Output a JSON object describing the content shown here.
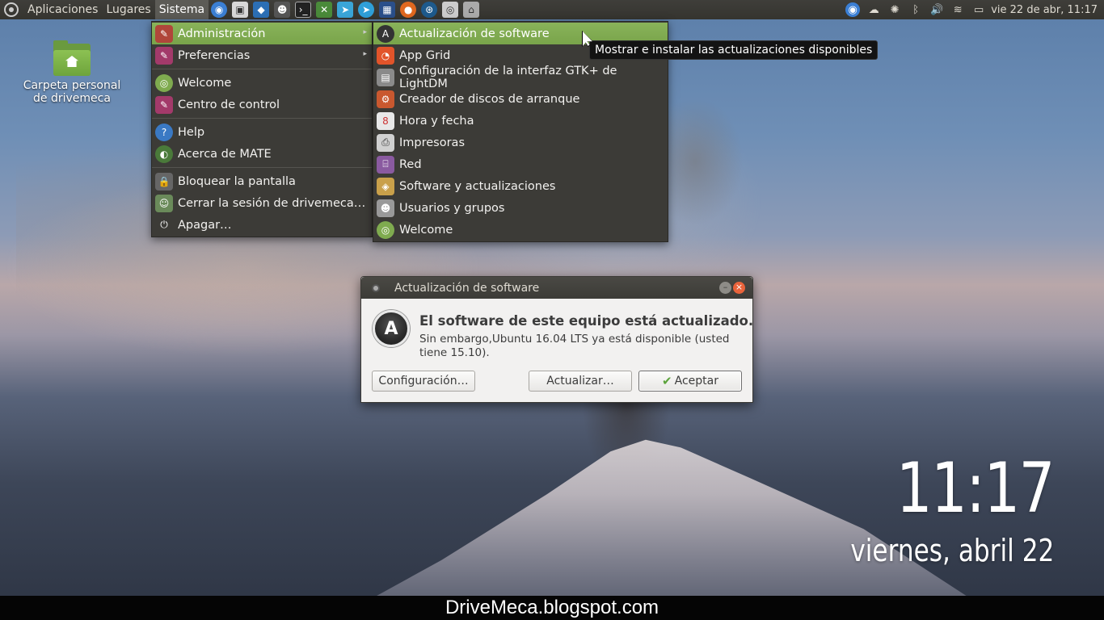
{
  "panel": {
    "menus": [
      "Aplicaciones",
      "Lugares",
      "Sistema"
    ],
    "launchers": [
      "chromium-icon",
      "screenshot-icon",
      "virtualbox-icon",
      "app-icon",
      "terminal-icon",
      "tools-icon",
      "telegram-icon",
      "telegram-desktop-icon",
      "calculator-icon",
      "firefox-icon",
      "steam-icon",
      "disk-icon",
      "network-icon"
    ],
    "clock": "vie 22 de abr, 11:17"
  },
  "desktop": {
    "home_folder_label": "Carpeta personal de drivemeca",
    "clock_time": "11:17",
    "clock_date": "viernes, abril 22"
  },
  "system_menu": {
    "items": [
      {
        "label": "Administración",
        "icon": "admin-icon"
      },
      {
        "label": "Preferencias",
        "icon": "preferences-icon"
      },
      {
        "label": "Welcome",
        "icon": "ubuntu-mate-icon"
      },
      {
        "label": "Centro de control",
        "icon": "control-center-icon"
      },
      {
        "label": "Help",
        "icon": "help-icon"
      },
      {
        "label": "Acerca de MATE",
        "icon": "mate-icon"
      },
      {
        "label": "Bloquear la pantalla",
        "icon": "lock-icon"
      },
      {
        "label": "Cerrar la sesión de drivemeca…",
        "icon": "logout-icon"
      },
      {
        "label": "Apagar…",
        "icon": "power-icon"
      }
    ]
  },
  "admin_submenu": {
    "items": [
      {
        "label": "Actualización de software",
        "icon": "software-updater-icon"
      },
      {
        "label": "App Grid",
        "icon": "app-grid-icon"
      },
      {
        "label": "Configuración de la interfaz GTK+ de LightDM",
        "icon": "lightdm-icon"
      },
      {
        "label": "Creador de discos de arranque",
        "icon": "usb-creator-icon"
      },
      {
        "label": "Hora y fecha",
        "icon": "calendar-icon"
      },
      {
        "label": "Impresoras",
        "icon": "printer-icon"
      },
      {
        "label": "Red",
        "icon": "network-icon"
      },
      {
        "label": "Software y actualizaciones",
        "icon": "software-properties-icon"
      },
      {
        "label": "Usuarios y grupos",
        "icon": "users-icon"
      },
      {
        "label": "Welcome",
        "icon": "ubuntu-mate-icon"
      }
    ]
  },
  "tooltip": "Mostrar e instalar las actualizaciones disponibles",
  "dialog": {
    "title": "Actualización de software",
    "headline": "El software de este equipo está actualizado.",
    "message": "Sin embargo,Ubuntu 16.04 LTS ya está disponible (usted tiene 15.10).",
    "buttons": {
      "settings": "Configuración…",
      "update": "Actualizar…",
      "accept": "Aceptar"
    }
  },
  "banner": "DriveMeca.blogspot.com",
  "colors": {
    "menu_highlight": "#7fab4f",
    "panel_bg": "#3c3b37",
    "close_button": "#e9633b"
  }
}
